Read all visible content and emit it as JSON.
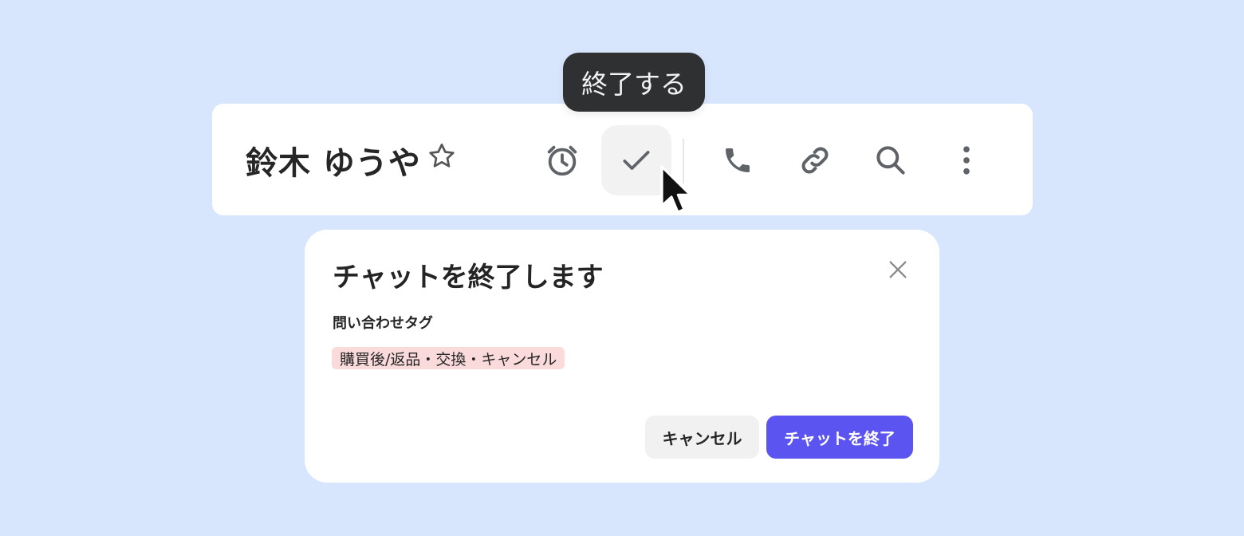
{
  "tooltip": {
    "text": "終了する"
  },
  "header": {
    "contact_name": "鈴木 ゆうや",
    "icons": {
      "favorite": "star-outline-icon",
      "snooze": "alarm-clock-icon",
      "complete": "checkmark-icon",
      "call": "phone-icon",
      "link": "link-icon",
      "search": "search-icon",
      "more": "more-vertical-icon"
    }
  },
  "dialog": {
    "title": "チャットを終了します",
    "tag_label": "問い合わせタグ",
    "tags": [
      "購買後/返品・交換・キャンセル"
    ],
    "cancel_label": "キャンセル",
    "confirm_label": "チャットを終了"
  },
  "colors": {
    "background": "#d7e5fd",
    "tooltip_bg": "#2f3032",
    "tag_bg": "#fadadb",
    "primary": "#5b54f0",
    "icon": "#5f6368"
  }
}
